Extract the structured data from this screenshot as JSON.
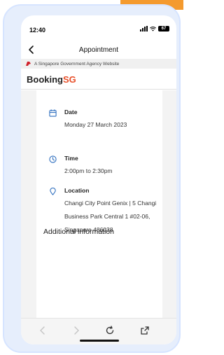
{
  "status_bar": {
    "time": "12:40",
    "battery": "67"
  },
  "nav": {
    "title": "Appointment"
  },
  "banner": {
    "text": "A Singapore Government Agency Website"
  },
  "header": {
    "logo_prefix": "Booking",
    "logo_suffix": "SG"
  },
  "details": {
    "date": {
      "label": "Date",
      "value": "Monday 27 March 2023",
      "icon": "calendar-icon"
    },
    "time": {
      "label": "Time",
      "value": "2:00pm to 2:30pm",
      "icon": "clock-icon"
    },
    "location": {
      "label": "Location",
      "value": "Changi City Point Genix | 5 Changi Business Park Central 1 #02-06, Singapore 486038",
      "icon": "location-pin-icon"
    }
  },
  "additional": {
    "heading": "Additional information"
  },
  "colors": {
    "brand_accent": "#e8502a",
    "frame": "#e6eefc",
    "icon_blue": "#2f6fbf"
  }
}
